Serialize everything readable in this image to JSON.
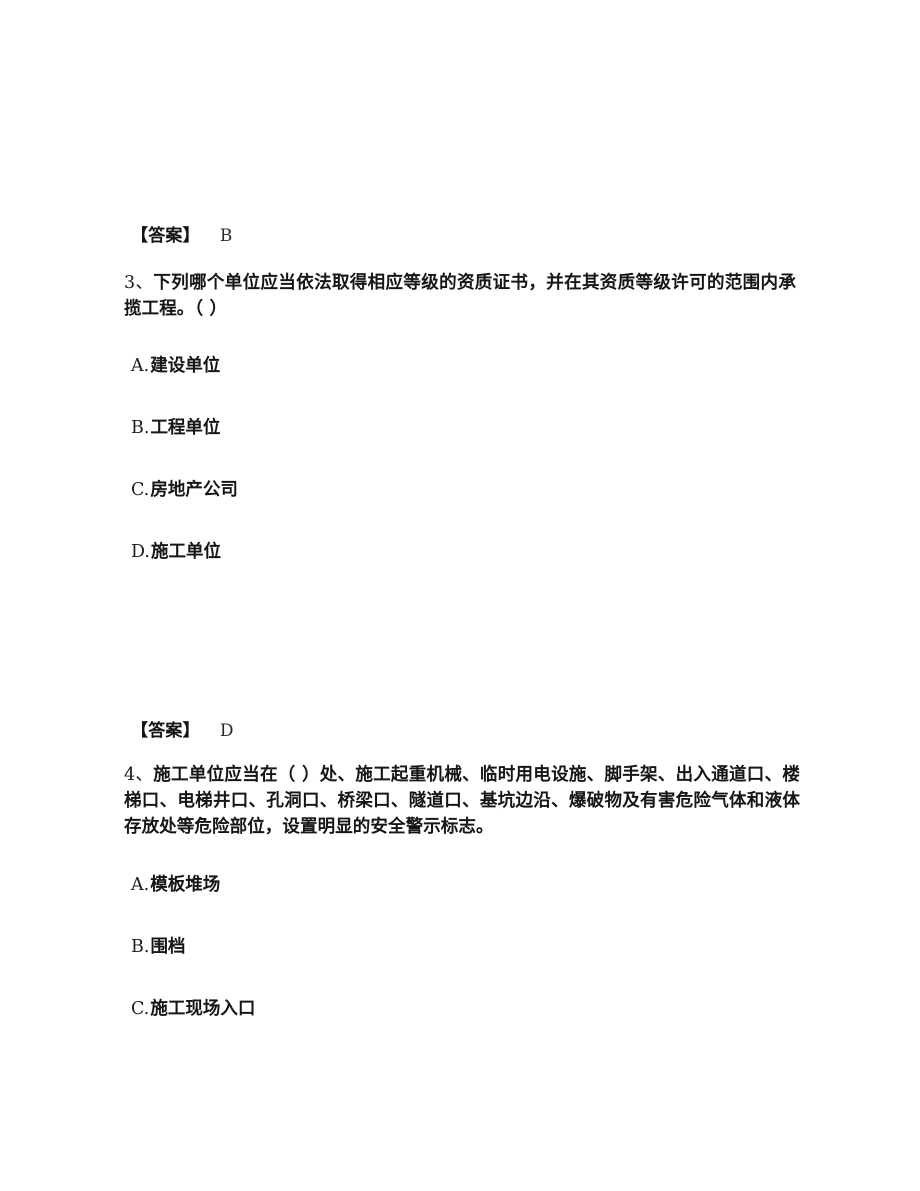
{
  "document": {
    "type": "exam-question-sheet",
    "language": "zh-CN",
    "background_color": "#ffffff",
    "text_color": "#161616"
  },
  "blocks": [
    {
      "kind": "answer",
      "label": "【答案】",
      "value": "B"
    },
    {
      "kind": "question",
      "number": "3、",
      "text": "下列哪个单位应当依法取得相应等级的资质证书，并在其资质等级许可的范围内承揽工程。（ ）",
      "options": [
        {
          "label": "A.",
          "text": "建设单位"
        },
        {
          "label": "B.",
          "text": "工程单位"
        },
        {
          "label": "C.",
          "text": "房地产公司"
        },
        {
          "label": "D.",
          "text": "施工单位"
        }
      ]
    },
    {
      "kind": "answer",
      "label": "【答案】",
      "value": "D"
    },
    {
      "kind": "question",
      "number": "4、",
      "text": "施工单位应当在（ ）处、施工起重机械、临时用电设施、脚手架、出入通道口、楼梯口、电梯井口、孔洞口、桥梁口、隧道口、基坑边沿、爆破物及有害危险气体和液体存放处等危险部位，设置明显的安全警示标志。",
      "options": [
        {
          "label": "A.",
          "text": "模板堆场"
        },
        {
          "label": "B.",
          "text": "围档"
        },
        {
          "label": "C.",
          "text": "施工现场入口"
        }
      ]
    }
  ]
}
